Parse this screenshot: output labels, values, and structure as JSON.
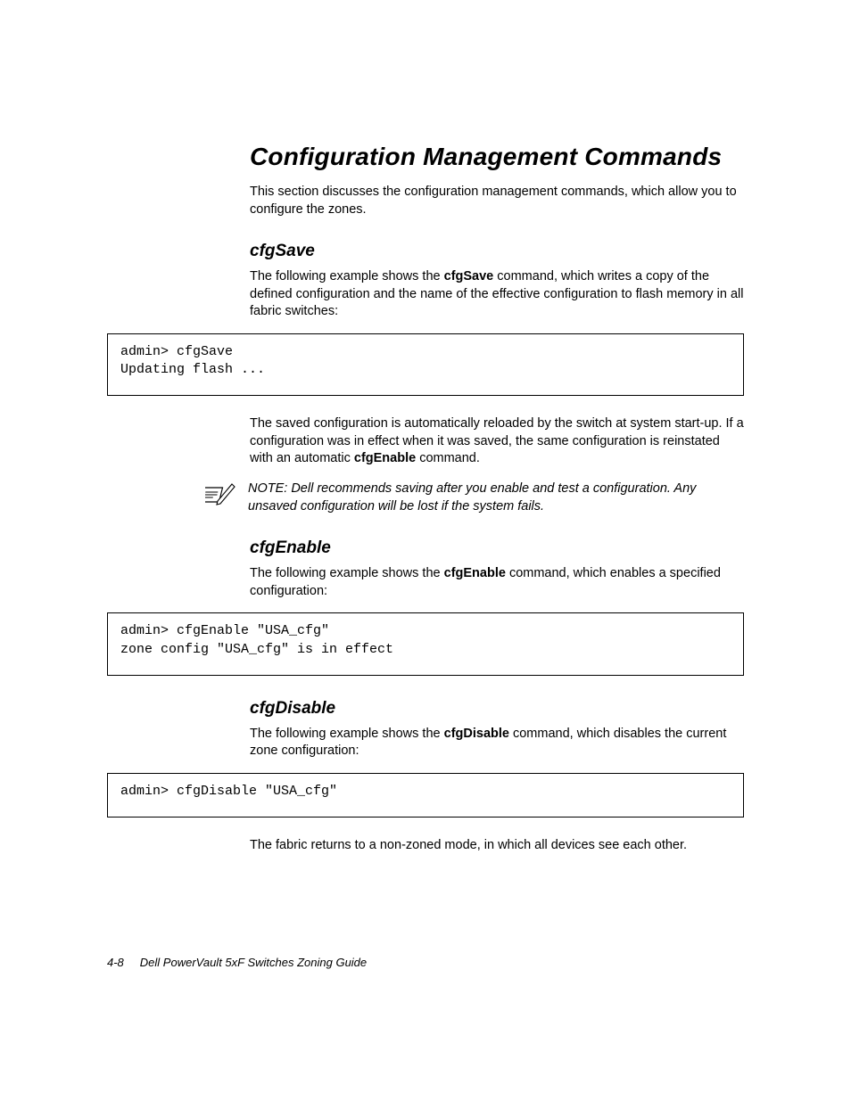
{
  "title": "Configuration Management Commands",
  "intro": "This section discusses the configuration management commands, which allow you to configure the zones.",
  "s1": {
    "h": "cfgSave",
    "p1a": "The following example shows the ",
    "p1cmd": "cfgSave",
    "p1b": " command, which writes a copy of the defined configuration and the name of the effective configuration to flash memory in all fabric switches:",
    "code": "admin> cfgSave\nUpdating flash ...",
    "p2a": "The saved configuration is automatically reloaded by the switch at system start-up. If a configuration was in effect when it was saved, the same configuration is reinstated with an automatic ",
    "p2cmd": "cfgEnable",
    "p2b": " command.",
    "note": "NOTE: Dell recommends saving after you enable and test a configuration. Any unsaved configuration will be lost if the system fails."
  },
  "s2": {
    "h": "cfgEnable",
    "p1a": "The following example shows the ",
    "p1cmd": "cfgEnable",
    "p1b": " command, which enables a specified configuration:",
    "code": "admin> cfgEnable \"USA_cfg\"\nzone config \"USA_cfg\" is in effect"
  },
  "s3": {
    "h": "cfgDisable",
    "p1a": "The following example shows the ",
    "p1cmd": "cfgDisable",
    "p1b": " command, which disables the current zone configuration:",
    "code": "admin> cfgDisable \"USA_cfg\"",
    "p2": "The fabric returns to a non-zoned mode, in which all devices see each other."
  },
  "footer": {
    "pagenum": "4-8",
    "title": "Dell PowerVault 5xF Switches Zoning Guide"
  }
}
